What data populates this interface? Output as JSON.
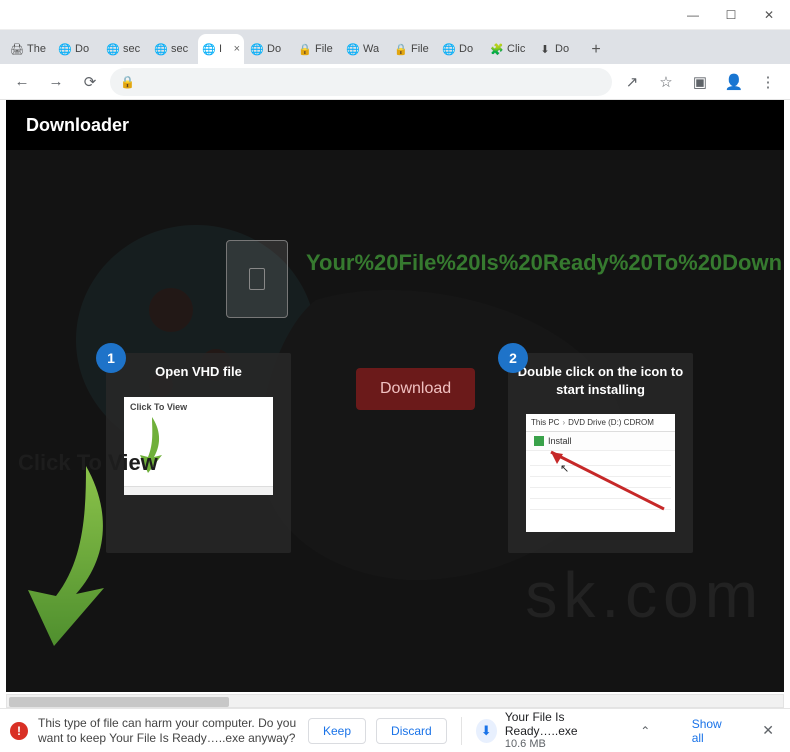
{
  "window": {
    "min": "—",
    "max": "☐",
    "close": "✕"
  },
  "tabs": [
    {
      "favicon": "🖨",
      "title": "The"
    },
    {
      "favicon": "🌐",
      "title": "Do"
    },
    {
      "favicon": "🌐",
      "title": "sec"
    },
    {
      "favicon": "🌐",
      "title": "sec"
    },
    {
      "favicon": "🌐",
      "title": "I",
      "active": true
    },
    {
      "favicon": "🌐",
      "title": "Do"
    },
    {
      "favicon": "🔒",
      "title": "File"
    },
    {
      "favicon": "🌐",
      "title": "Wa"
    },
    {
      "favicon": "🔒",
      "title": "File"
    },
    {
      "favicon": "🌐",
      "title": "Do"
    },
    {
      "favicon": "🧩",
      "title": "Clic"
    },
    {
      "favicon": "⬇",
      "title": "Do"
    }
  ],
  "toolbar": {
    "back": "←",
    "fwd": "→",
    "reload": "⟳",
    "lock": "🔒",
    "share": "↗",
    "star": "☆",
    "ext": "▣",
    "profile": "👤",
    "menu": "⋮",
    "newtab": "+"
  },
  "page": {
    "header": "Downloader",
    "ready_text": "Your%20File%20Is%20Ready%20To%20Down",
    "download_btn": "Download",
    "watermark": "sk.com",
    "step1": {
      "num": "1",
      "title": "Open VHD file",
      "thumb_text": "Click To View"
    },
    "step2": {
      "num": "2",
      "title": "Double click on the icon to start installing",
      "path_a": "This PC",
      "path_b": "DVD Drive (D:) CDROM",
      "install": "Install"
    },
    "ctv": "Click To View"
  },
  "shelf": {
    "warn": "This type of file can harm your computer. Do you want to keep Your File Is Ready…..exe anyway?",
    "keep": "Keep",
    "discard": "Discard",
    "file": "Your File Is Ready…..exe",
    "size": "10.6 MB",
    "chev": "⌃",
    "showall": "Show all",
    "close": "✕",
    "dl_glyph": "⬇"
  }
}
